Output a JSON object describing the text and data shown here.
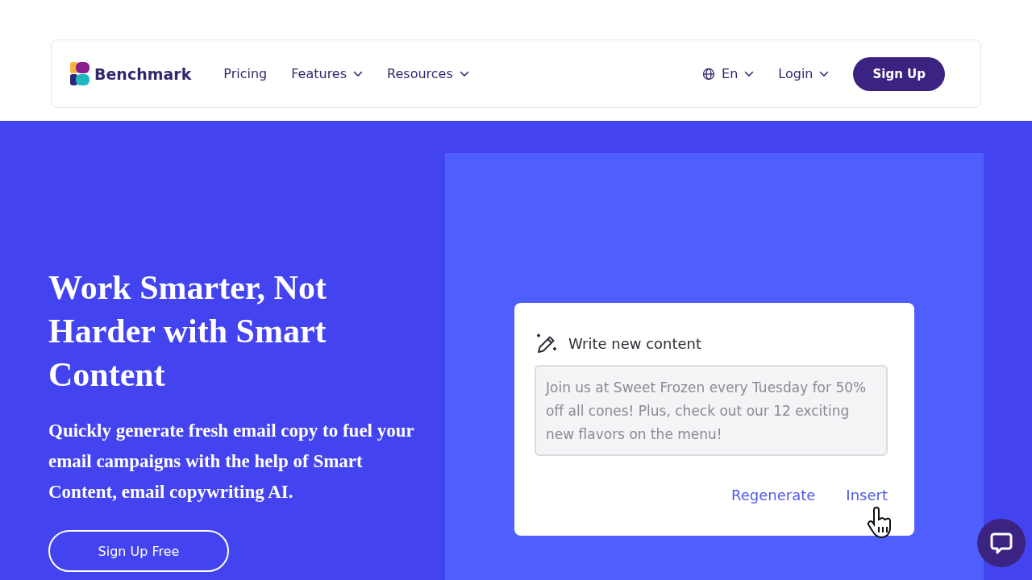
{
  "header": {
    "brand": "Benchmark",
    "nav": [
      {
        "label": "Pricing",
        "dropdown": false
      },
      {
        "label": "Features",
        "dropdown": true
      },
      {
        "label": "Resources",
        "dropdown": true
      }
    ],
    "language": "En",
    "login": "Login",
    "signup": "Sign Up"
  },
  "hero": {
    "heading": "Work Smarter, Not Harder with Smart Content",
    "description": "Quickly generate fresh email copy to fuel your email campaigns with the help of Smart Content, email copywriting AI.",
    "cta": "Sign Up Free"
  },
  "card": {
    "title": "Write new content",
    "text": "Join us at Sweet Frozen every Tuesday for 50% off all cones! Plus, check out our 12 exciting new flavors on the menu!",
    "actions": [
      "Regenerate",
      "Insert"
    ]
  }
}
